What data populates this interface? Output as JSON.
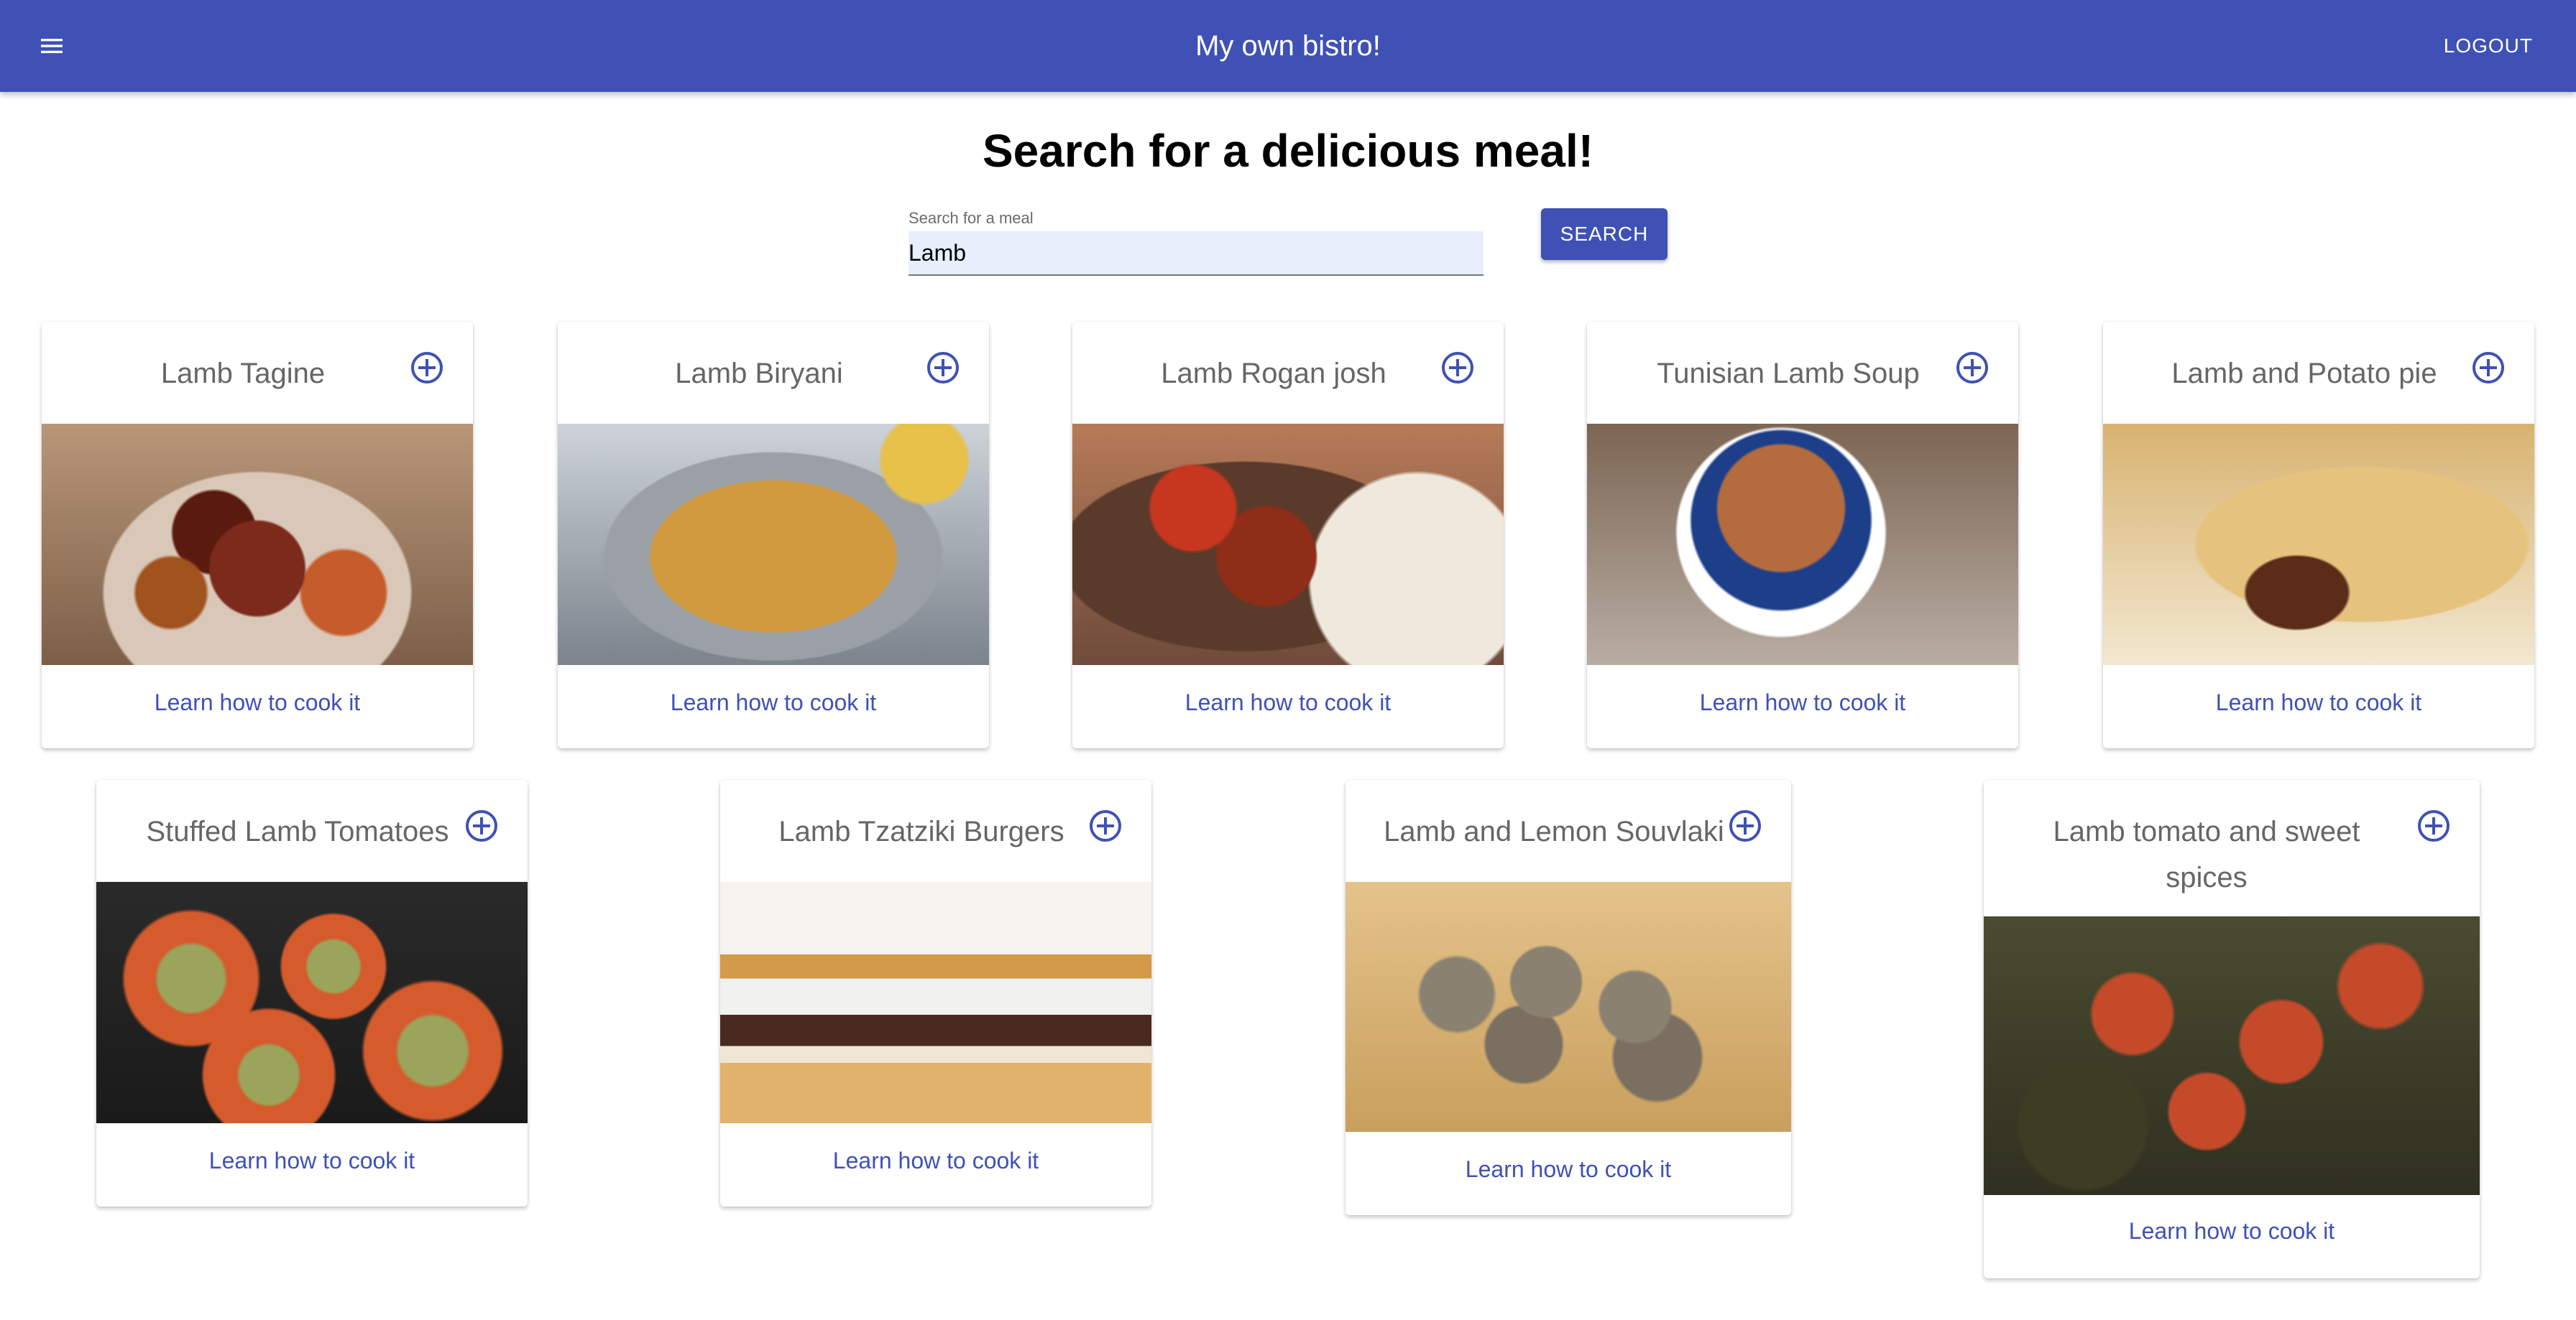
{
  "appbar": {
    "title": "My own bistro!",
    "menu_icon": "menu-icon",
    "logout_label": "LOGOUT",
    "color": "#3f51b5"
  },
  "search": {
    "heading": "Search for a delicious meal!",
    "label": "Search for a meal",
    "value": "Lamb",
    "button_label": "SEARCH"
  },
  "cards": [
    {
      "title": "Lamb Tagine",
      "link": "Learn how to cook it",
      "image": "lamb-tagine-photo"
    },
    {
      "title": "Lamb Biryani",
      "link": "Learn how to cook it",
      "image": "lamb-biryani-photo"
    },
    {
      "title": "Lamb Rogan josh",
      "link": "Learn how to cook it",
      "image": "lamb-rogan-josh-photo"
    },
    {
      "title": "Tunisian Lamb Soup",
      "link": "Learn how to cook it",
      "image": "tunisian-lamb-soup-photo"
    },
    {
      "title": "Lamb and Potato pie",
      "link": "Learn how to cook it",
      "image": "lamb-potato-pie-photo"
    },
    {
      "title": "Stuffed Lamb Tomatoes",
      "link": "Learn how to cook it",
      "image": "stuffed-lamb-tomatoes-photo"
    },
    {
      "title": "Lamb Tzatziki Burgers",
      "link": "Learn how to cook it",
      "image": "lamb-tzatziki-burgers-photo"
    },
    {
      "title": "Lamb and Lemon Souvlaki",
      "link": "Learn how to cook it",
      "image": "lamb-lemon-souvlaki-photo"
    },
    {
      "title": "Lamb tomato and sweet spices",
      "link": "Learn how to cook it",
      "image": "lamb-tomato-sweet-spices-photo"
    }
  ],
  "icons": {
    "add": "add-circle-icon"
  }
}
